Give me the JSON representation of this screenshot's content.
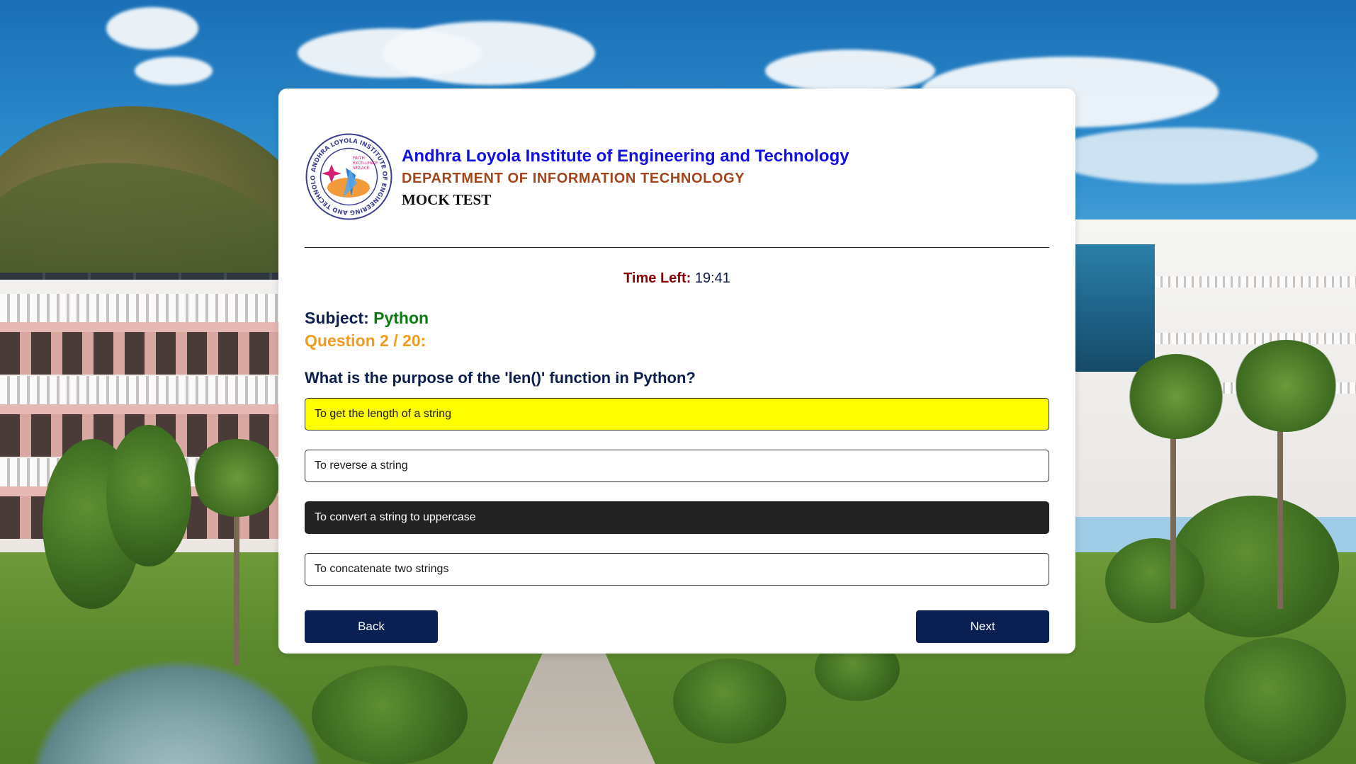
{
  "header": {
    "college_name": "Andhra Loyola Institute of Engineering and Technology",
    "department": "DEPARTMENT OF INFORMATION TECHNOLOGY",
    "test_title": "MOCK TEST",
    "logo": {
      "ring_text": "ANDHRA LOYOLA INSTITUTE OF ENGINEERING AND TECHNOLOGY",
      "motto": [
        "FAITH",
        "EXCELLENCE",
        "SERVICE"
      ],
      "icon": "college-emblem-icon"
    }
  },
  "timer": {
    "label": "Time Left:",
    "value": "19:41"
  },
  "quiz": {
    "subject_label": "Subject:",
    "subject_value": "Python",
    "question_counter": "Question 2 / 20:",
    "question_text": "What is the purpose of the 'len()' function in Python?",
    "options": [
      {
        "text": "To get the length of a string",
        "state": "selected"
      },
      {
        "text": "To reverse a string",
        "state": "default"
      },
      {
        "text": "To convert a string to uppercase",
        "state": "hover"
      },
      {
        "text": "To concatenate two strings",
        "state": "default"
      }
    ]
  },
  "nav": {
    "back_label": "Back",
    "next_label": "Next"
  },
  "colors": {
    "college_name": "#1010e6",
    "department": "#a0461e",
    "time_label": "#8b0000",
    "subject_value": "#0a7a12",
    "question_counter": "#f29b1c",
    "selected_option": "#ffff00",
    "hover_option": "#222222",
    "button_bg": "#0a1f52"
  }
}
